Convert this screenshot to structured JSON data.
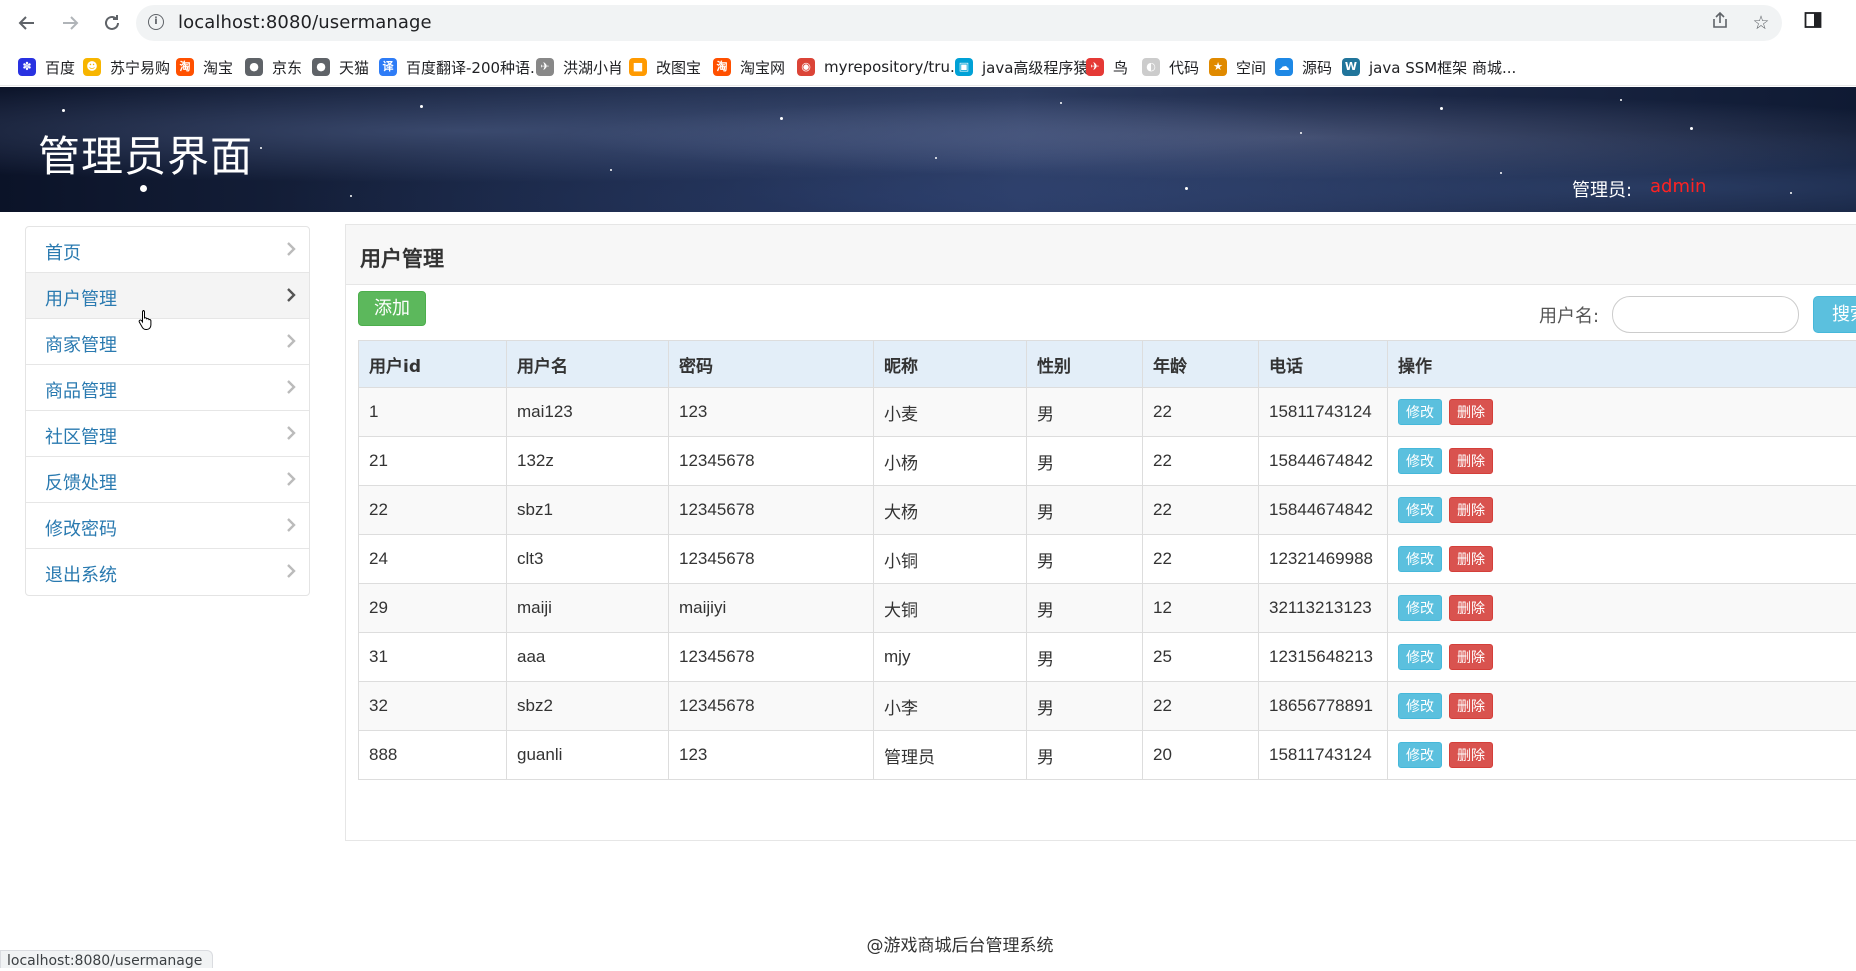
{
  "browser": {
    "url": "localhost:8080/usermanage",
    "status_url": "localhost:8080/usermanage",
    "icons": [
      "back-icon",
      "forward-icon",
      "reload-icon",
      "info-icon",
      "share-icon",
      "star-icon",
      "sidepanel-icon",
      "profile-icon"
    ],
    "bookmarks": [
      {
        "label": "百度",
        "icon": "baidu-icon",
        "color": "#2932e1"
      },
      {
        "label": "苏宁易购",
        "icon": "suning-icon",
        "color": "#f7b500"
      },
      {
        "label": "淘宝",
        "icon": "taobao-icon",
        "color": "#ff5000"
      },
      {
        "label": "京东",
        "icon": "globe-icon",
        "color": "#5f6368"
      },
      {
        "label": "天猫",
        "icon": "globe-icon",
        "color": "#5f6368"
      },
      {
        "label": "百度翻译-200种语...",
        "icon": "translate-icon",
        "color": "#2e7cf6"
      },
      {
        "label": "洪湖小肖",
        "icon": "bird-icon",
        "color": "#888888"
      },
      {
        "label": "改图宝",
        "icon": "gaitubao-icon",
        "color": "#ff9a00"
      },
      {
        "label": "淘宝网",
        "icon": "taobao-icon",
        "color": "#ff5000"
      },
      {
        "label": "myrepository/tru...",
        "icon": "chrome-icon",
        "color": "#db4437"
      },
      {
        "label": "java高级程序猿",
        "icon": "bilibili-icon",
        "color": "#00a1d6"
      },
      {
        "label": "鸟",
        "icon": "bird-icon",
        "color": "#e53935"
      },
      {
        "label": "代码",
        "icon": "code-icon",
        "color": "#cccccc"
      },
      {
        "label": "空间",
        "icon": "qzone-icon",
        "color": "#e08a00"
      },
      {
        "label": "源码",
        "icon": "cloud-icon",
        "color": "#1e88e5"
      },
      {
        "label": "java SSM框架 商城...",
        "icon": "wordpress-icon",
        "color": "#21759b"
      }
    ]
  },
  "header": {
    "title": "管理员界面",
    "admin_label": "管理员:",
    "admin_name": "admin",
    "admin_name_color": "#ff2222"
  },
  "sidebar": {
    "items": [
      {
        "label": "首页"
      },
      {
        "label": "用户管理"
      },
      {
        "label": "商家管理"
      },
      {
        "label": "商品管理"
      },
      {
        "label": "社区管理"
      },
      {
        "label": "反馈处理"
      },
      {
        "label": "修改密码"
      },
      {
        "label": "退出系统"
      }
    ],
    "active_item": "用户管理"
  },
  "main": {
    "title": "用户管理",
    "add_button": "添加",
    "search_label": "用户名:",
    "search_value": "",
    "search_button": "搜索",
    "table": {
      "columns": [
        "用户id",
        "用户名",
        "密码",
        "昵称",
        "性别",
        "年龄",
        "电话",
        "操作"
      ],
      "rows": [
        [
          "1",
          "mai123",
          "123",
          "小麦",
          "男",
          "22",
          "15811743124"
        ],
        [
          "21",
          "132z",
          "12345678",
          "小杨",
          "男",
          "22",
          "15844674842"
        ],
        [
          "22",
          "sbz1",
          "12345678",
          "大杨",
          "男",
          "22",
          "15844674842"
        ],
        [
          "24",
          "clt3",
          "12345678",
          "小铜",
          "男",
          "22",
          "12321469988"
        ],
        [
          "29",
          "maiji",
          "maijiyi",
          "大铜",
          "男",
          "12",
          "32113213123"
        ],
        [
          "31",
          "aaa",
          "12345678",
          "mjy",
          "男",
          "25",
          "12315648213"
        ],
        [
          "32",
          "sbz2",
          "12345678",
          "小李",
          "男",
          "22",
          "18656778891"
        ],
        [
          "888",
          "guanli",
          "123",
          "管理员",
          "男",
          "20",
          "15811743124"
        ]
      ],
      "edit_label": "修改",
      "delete_label": "删除"
    }
  },
  "footer": {
    "text": "@游戏商城后台管理系统"
  },
  "colors": {
    "add_button": "#5cb85c",
    "edit_button": "#5bc0de",
    "delete_button": "#d9534f",
    "sidebar_link": "#2a7ab0",
    "table_header": "#e3eef8"
  }
}
